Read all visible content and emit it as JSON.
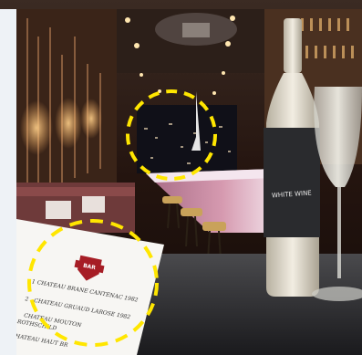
{
  "colors": {
    "topbar": "#1aa2df",
    "marker": "#ffe600",
    "badge": "#a61d25",
    "wine_label": "#2a2b2e"
  },
  "bottle": {
    "label_text": "WHITE WINE"
  },
  "menu": {
    "badge_text": "BAR",
    "items": [
      {
        "number": "1",
        "text": "CHATEAU BRANE CANTENAC 1982"
      },
      {
        "number": "2",
        "text": "CHATEAU GRUAUD LAROSE 1982"
      },
      {
        "number": "3",
        "text": "CHATEAU MOUTON"
      },
      {
        "number": "",
        "text": "ROTHSCHILD"
      },
      {
        "number": "",
        "text": "CHATEAU HAUT BR"
      }
    ]
  },
  "markers": [
    {
      "name": "difference-marker-window",
      "shape": "ellipse"
    },
    {
      "name": "difference-marker-menu",
      "shape": "ellipse"
    }
  ]
}
